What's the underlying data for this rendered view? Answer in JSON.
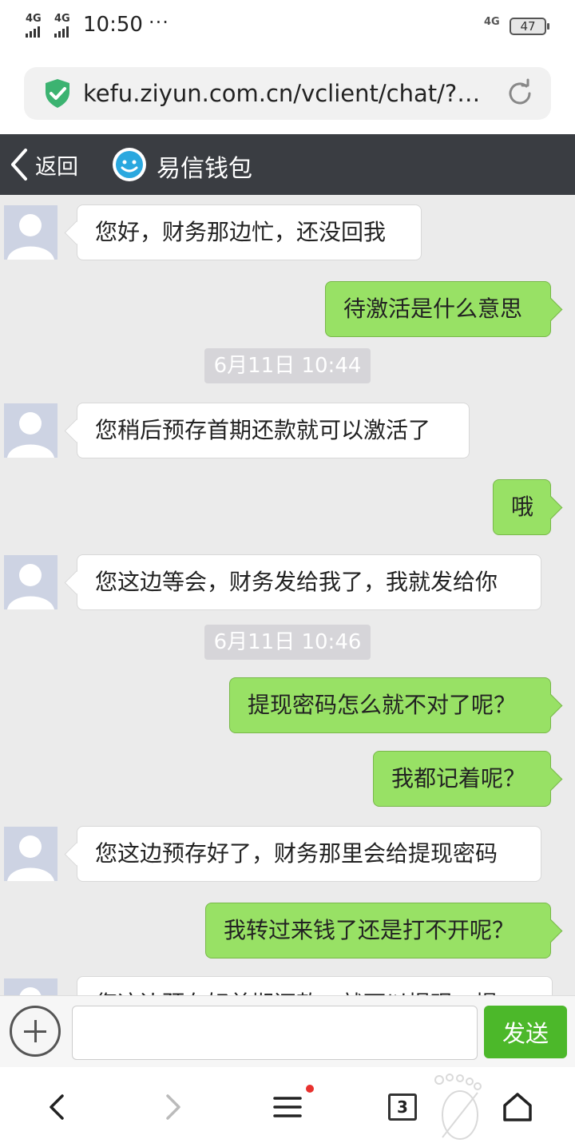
{
  "status_bar": {
    "signal_1": "4G",
    "signal_2": "4G",
    "time": "10:50",
    "more": "···",
    "net_right": "4G",
    "battery": "47"
  },
  "browser": {
    "url": "kefu.ziyun.com.cn/vclient/chat/?w…"
  },
  "header": {
    "back_label": "返回",
    "title": "易信钱包"
  },
  "messages": [
    {
      "side": "left",
      "text": "您好，财务那边忙，还没回我"
    },
    {
      "side": "right",
      "text": "待激活是什么意思"
    },
    {
      "type": "time",
      "text": "6月11日 10:44"
    },
    {
      "side": "left",
      "text": "您稍后预存首期还款就可以激活了"
    },
    {
      "side": "right",
      "text": "哦"
    },
    {
      "side": "left",
      "text": "您这边等会，财务发给我了，我就发给你"
    },
    {
      "type": "time",
      "text": "6月11日 10:46"
    },
    {
      "side": "right",
      "text": "提现密码怎么就不对了呢？"
    },
    {
      "side": "right",
      "text": "我都记着呢？"
    },
    {
      "side": "left",
      "text": "您这边预存好了，财务那里会给提现密码"
    },
    {
      "side": "right",
      "text": "我转过来钱了还是打不开呢？"
    },
    {
      "side": "left",
      "text": "您这边预存好首期还款，就可以提现，提"
    }
  ],
  "input": {
    "value": "",
    "send_label": "发送"
  },
  "bottom_nav": {
    "tab_count": "3"
  },
  "colors": {
    "header_bg": "#3a3d42",
    "bubble_out": "#98e165",
    "send_button": "#4cb82a",
    "chat_bg": "#ebebeb"
  }
}
